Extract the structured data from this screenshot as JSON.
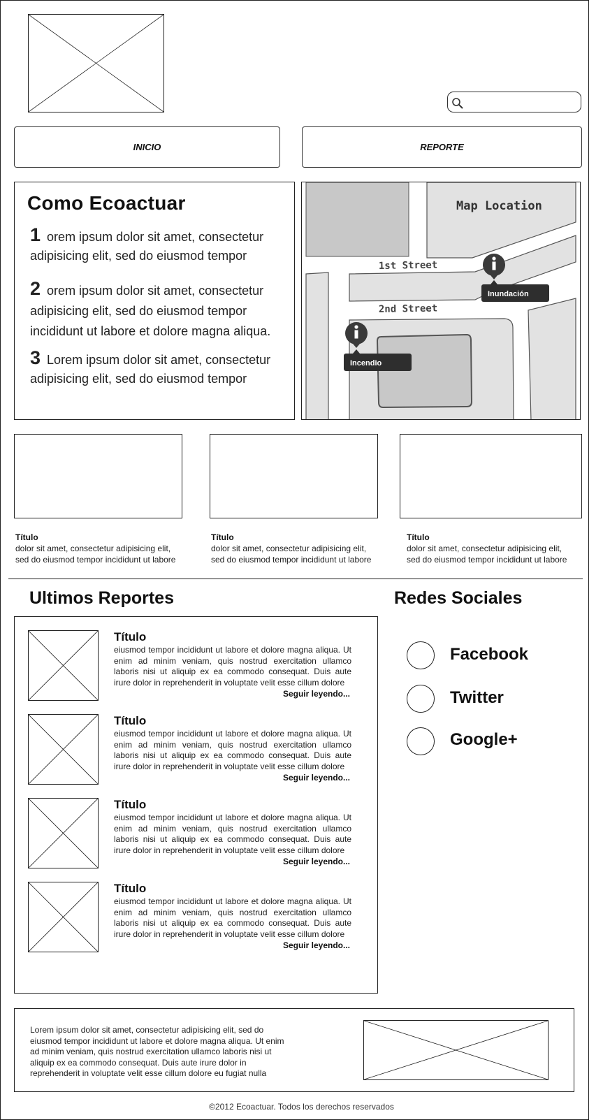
{
  "header": {
    "logo_icon": "image-placeholder-icon",
    "search": {
      "placeholder": "",
      "icon": "search-icon"
    }
  },
  "nav": {
    "items": [
      {
        "label": "INICIO"
      },
      {
        "label": "REPORTE"
      }
    ]
  },
  "how": {
    "title": "Como Ecoactuar",
    "steps": [
      {
        "num": "1",
        "text": "orem ipsum dolor sit amet, consectetur adipisicing elit, sed do eiusmod tempor"
      },
      {
        "num": "2",
        "text": "orem ipsum dolor sit amet, consectetur adipisicing elit, sed do eiusmod tempor incididunt ut labore et dolore magna aliqua."
      },
      {
        "num": "3",
        "text": "Lorem ipsum dolor sit amet, consectetur adipisicing elit, sed do eiusmod tempor"
      }
    ]
  },
  "map": {
    "title": "Map Location",
    "street1": "1st Street",
    "street2": "2nd Street",
    "markers": [
      {
        "label": "Inundación",
        "icon": "info-icon"
      },
      {
        "label": "Incendio",
        "icon": "info-icon"
      }
    ]
  },
  "cards": [
    {
      "title": "Título",
      "line1": "dolor sit amet, consectetur adipisicing elit,",
      "line2": "sed do eiusmod tempor incididunt ut labore"
    },
    {
      "title": "Título",
      "line1": "dolor sit amet, consectetur adipisicing elit,",
      "line2": "sed do eiusmod tempor incididunt ut labore"
    },
    {
      "title": "Título",
      "line1": "dolor sit amet, consectetur adipisicing elit,",
      "line2": "sed do eiusmod tempor incididunt ut labore"
    }
  ],
  "reports": {
    "title": "Ultimos Reportes",
    "items": [
      {
        "title": "Título",
        "text": "eiusmod tempor incididunt ut labore et dolore magna aliqua. Ut enim ad minim veniam, quis nostrud exercitation ullamco laboris nisi ut aliquip ex ea commodo consequat. Duis aute irure dolor in reprehenderit in voluptate velit esse cillum dolore",
        "more": "Seguir leyendo..."
      },
      {
        "title": "Título",
        "text": "eiusmod tempor incididunt ut labore et dolore magna aliqua. Ut enim ad minim veniam, quis nostrud exercitation ullamco laboris nisi ut aliquip ex ea commodo consequat. Duis aute irure dolor in reprehenderit in voluptate velit esse cillum dolore",
        "more": "Seguir leyendo..."
      },
      {
        "title": "Título",
        "text": "eiusmod tempor incididunt ut labore et dolore magna aliqua. Ut enim ad minim veniam, quis nostrud exercitation ullamco laboris nisi ut aliquip ex ea commodo consequat. Duis aute irure dolor in reprehenderit in voluptate velit esse cillum dolore",
        "more": "Seguir leyendo..."
      },
      {
        "title": "Título",
        "text": "eiusmod tempor incididunt ut labore et dolore magna aliqua. Ut enim ad minim veniam, quis nostrud exercitation ullamco laboris nisi ut aliquip ex ea commodo consequat. Duis aute irure dolor in reprehenderit in voluptate velit esse cillum dolore",
        "more": "Seguir leyendo..."
      }
    ]
  },
  "social": {
    "title": "Redes Sociales",
    "items": [
      {
        "label": "Facebook",
        "icon": "facebook-icon"
      },
      {
        "label": "Twitter",
        "icon": "twitter-icon"
      },
      {
        "label": "Google+",
        "icon": "google-plus-icon"
      }
    ]
  },
  "footer": {
    "text": "Lorem ipsum dolor sit amet, consectetur adipisicing elit, sed do eiusmod tempor incididunt ut labore et dolore magna aliqua. Ut enim ad minim veniam, quis nostrud exercitation ullamco laboris nisi ut aliquip ex ea commodo consequat. Duis aute irure dolor in reprehenderit in voluptate velit esse cillum dolore eu fugiat nulla",
    "copyright": "©2012 Ecoactuar. Todos los derechos reservados"
  }
}
